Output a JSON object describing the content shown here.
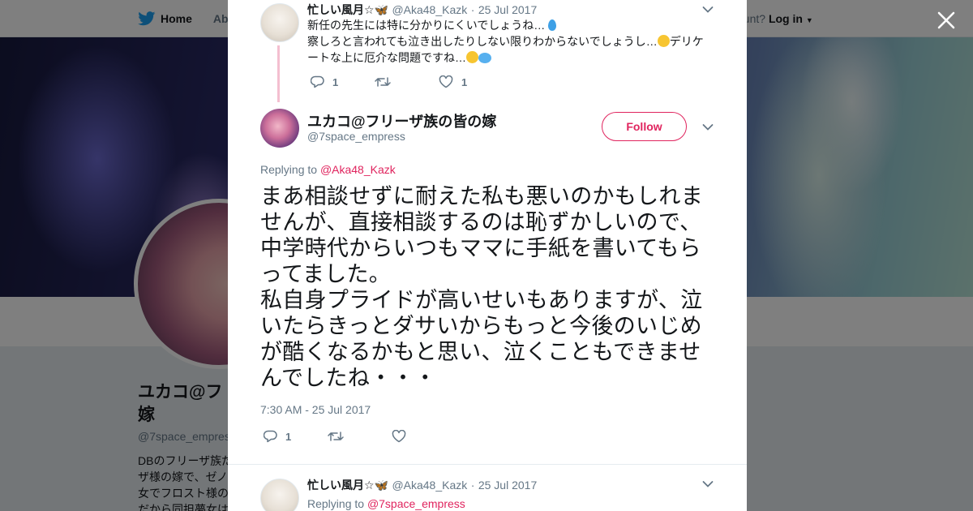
{
  "topbar": {
    "home_label": "Home",
    "about_label": "Abo",
    "account_prompt": "ccount?",
    "login_label": "Log in"
  },
  "profile": {
    "name": "ユカコ@フ 嫁",
    "handle": "@7space_empres",
    "bio_lines": [
      "DBのフリーザ族だ",
      "ザ様の嫁で、ゼノ",
      "女でフロスト様の夢",
      "だから同担夢女は"
    ]
  },
  "modal": {
    "parent_tweet": {
      "name": "忙しい風月☆🦋",
      "handle": "@Aka48_Kazk",
      "date": "25 Jul 2017",
      "line1": "新任の先生には特に分かりにくいでしょうね…",
      "line2a": "察しろと言われても泣き出したりしない限りわからないでしょうし…",
      "line2b": "デリケ",
      "line3": "ートな上に厄介な問題ですね…",
      "reply_count": "1",
      "like_count": "1"
    },
    "main_tweet": {
      "name": "ユカコ@フリーザ族の皆の嫁",
      "handle": "@7space_empress",
      "follow_label": "Follow",
      "replying_prefix": "Replying to",
      "replying_to": "@Aka48_Kazk",
      "text": "まあ相談せずに耐えた私も悪いのかもしれませんが、直接相談するのは恥ずかしいので、中学時代からいつもママに手紙を書いてもらってました。\n私自身プライドが高いせいもありますが、泣いたらきっとダサいからもっと今後のいじめが酷くなるかもと思い、泣くこともできませんでしたね・・・",
      "timestamp": "7:30 AM - 25 Jul 2017",
      "reply_count": "1"
    },
    "reply_tweet": {
      "name": "忙しい風月☆🦋",
      "handle": "@Aka48_Kazk",
      "date": "25 Jul 2017",
      "replying_prefix": "Replying to",
      "replying_to": "@7space_empress"
    }
  },
  "colors": {
    "accent": "#e0245e",
    "brand": "#1da1f2",
    "muted": "#657786"
  },
  "icons": [
    "twitter-bird-icon",
    "close-icon",
    "chevron-down-icon",
    "reply-icon",
    "retweet-icon",
    "heart-icon"
  ]
}
